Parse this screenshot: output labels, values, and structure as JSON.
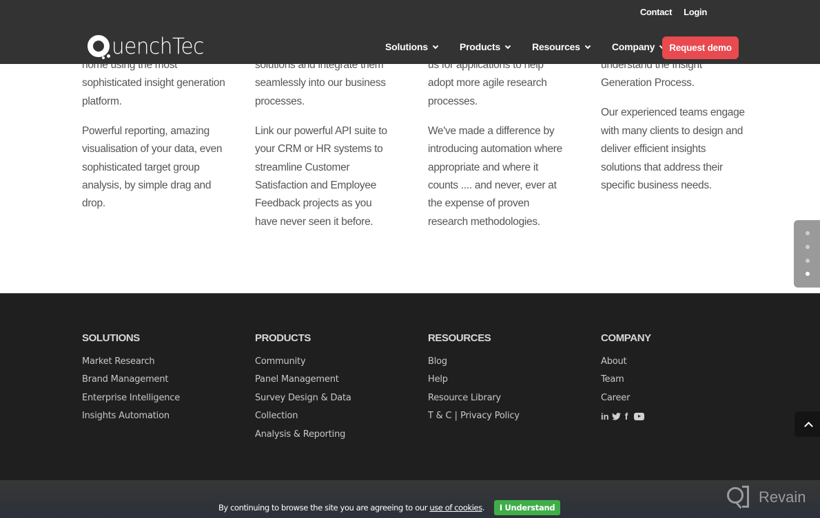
{
  "header": {
    "logo_text": "uenchTec",
    "top_links": [
      "Contact",
      "Login"
    ],
    "nav": [
      "Solutions",
      "Products",
      "Resources",
      "Company"
    ],
    "cta": "Request demo",
    "cta_color": "#e84a4f"
  },
  "content": {
    "columns": [
      {
        "paragraphs": [
          "home using the most sophisticated insight generation platform.",
          "Powerful reporting, amazing visualisation of your data, even sophisticated target group analysis, by simple drag and drop."
        ]
      },
      {
        "paragraphs": [
          "solutions and integrate them seamlessly into our business processes.",
          "Link our powerful API suite to your CRM or HR systems to streamline Customer Satisfaction and Employee Feedback projects as you have never seen it before."
        ]
      },
      {
        "paragraphs": [
          "us for applications to help adopt more agile research processes.",
          "We've made a difference by introducing automation where appropriate and where it counts .... and never, ever at the expense of proven research methodologies."
        ]
      },
      {
        "paragraphs": [
          "understand the Insight Generation Process.",
          "Our experienced teams engage with many clients to design and deliver efficient insights solutions that address their specific business needs."
        ]
      }
    ]
  },
  "dot_nav": {
    "count": 4,
    "active_index": 3
  },
  "footer": {
    "solutions": {
      "title": "SOLUTIONS",
      "links": [
        "Market Research",
        "Brand Management",
        "Enterprise Intelligence",
        "Insights Automation"
      ]
    },
    "products": {
      "title": "PRODUCTS",
      "links": [
        "Community",
        "Panel Management",
        "Survey Design & Data",
        "Collection",
        "Analysis & Reporting"
      ]
    },
    "resources": {
      "title": "RESOURCES",
      "links": [
        "Blog",
        "Help",
        "Resource Library"
      ],
      "tc": "T & C",
      "separator": "|",
      "privacy": "Privacy Policy"
    },
    "company": {
      "title": "COMPANY",
      "links": [
        "About",
        "Team",
        "Career"
      ],
      "social": {
        "linkedin": "in",
        "twitter": "❦",
        "facebook": "f"
      }
    }
  },
  "cookie": {
    "text": "By continuing to browse the site you are agreeing to our ",
    "link": "use of cookies",
    "suffix": ".",
    "button": "I Understand",
    "button_color": "#3fae49"
  },
  "watermark": {
    "text": "Revain"
  }
}
